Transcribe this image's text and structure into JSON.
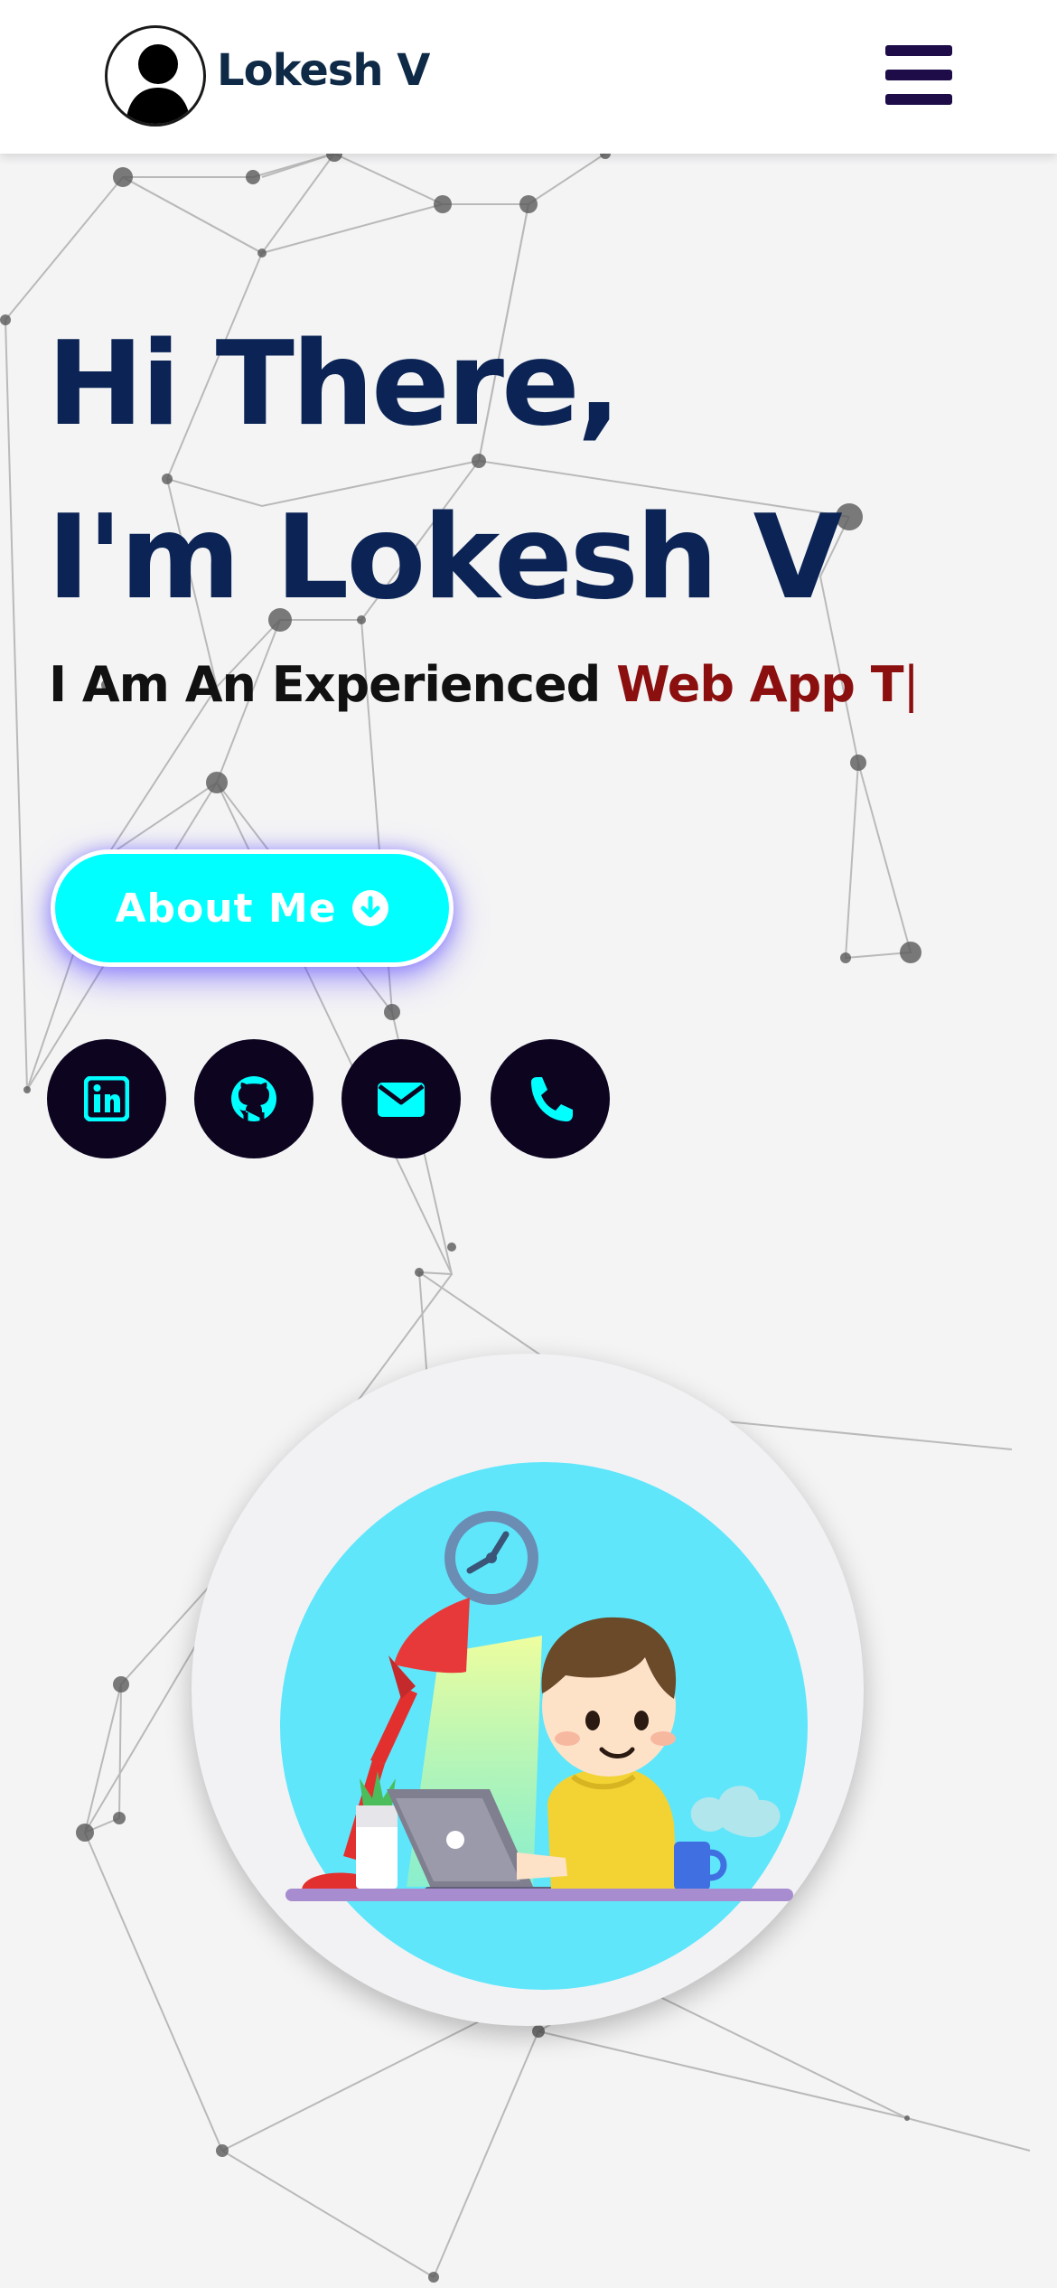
{
  "navbar": {
    "brand_name": "Lokesh V"
  },
  "hero": {
    "greeting_line1": "Hi There,",
    "greeting_line2": "I'm Lokesh V",
    "tagline_prefix": "I Am An Experienced",
    "tagline_typed": "Web App T",
    "tagline_caret": "|",
    "about_button_label": "About Me"
  },
  "socials": [
    {
      "name": "linkedin-icon"
    },
    {
      "name": "github-icon"
    },
    {
      "name": "mail-icon"
    },
    {
      "name": "phone-icon"
    }
  ],
  "colors": {
    "accent": "#00ffff",
    "heading": "#0b2455",
    "typed_text": "#8b0f0f",
    "social_bg": "#0d0420",
    "hamburger": "#1e0c48",
    "page_bg": "#f4f4f5"
  }
}
